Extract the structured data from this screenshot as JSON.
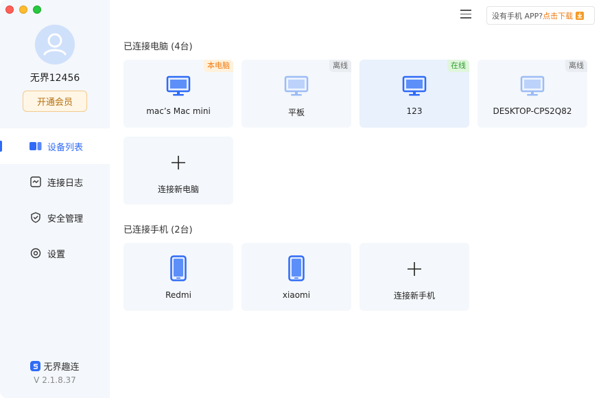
{
  "user": {
    "name": "无界12456",
    "vip_label": "开通会员"
  },
  "nav": [
    {
      "label": "设备列表",
      "icon": "device-list-icon",
      "active": true
    },
    {
      "label": "连接日志",
      "icon": "log-icon",
      "active": false
    },
    {
      "label": "安全管理",
      "icon": "shield-icon",
      "active": false
    },
    {
      "label": "设置",
      "icon": "gear-icon",
      "active": false
    }
  ],
  "brand": {
    "name": "无界趣连",
    "version": "V 2.1.8.37"
  },
  "topbar": {
    "tip_text": "没有手机 APP?",
    "tip_link": "点击下载"
  },
  "computers": {
    "title": "已连接电脑 (4台)",
    "items": [
      {
        "name": "mac’s Mac mini",
        "badge": "本电脑",
        "status": "local"
      },
      {
        "name": "平板",
        "badge": "离线",
        "status": "offline"
      },
      {
        "name": "123",
        "badge": "在线",
        "status": "online"
      },
      {
        "name": "DESKTOP-CPS2Q82",
        "badge": "离线",
        "status": "offline"
      }
    ],
    "add_label": "连接新电脑"
  },
  "phones": {
    "title": "已连接手机 (2台)",
    "items": [
      {
        "name": "Redmi"
      },
      {
        "name": "xiaomi"
      }
    ],
    "add_label": "连接新手机"
  },
  "colors": {
    "accent": "#2f6bf6",
    "orange": "#f07b10",
    "online": "#2f9e2f",
    "sidebar_bg": "#f4f7fb"
  }
}
